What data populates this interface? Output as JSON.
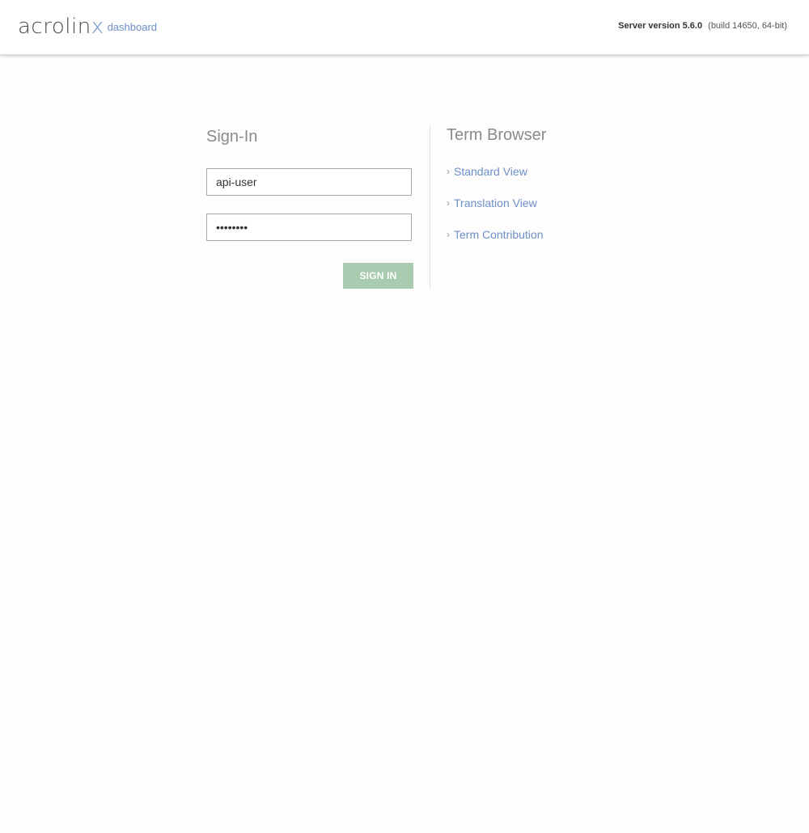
{
  "header": {
    "logo_text": "acrolin",
    "logo_x": "x",
    "logo_sub": "dashboard",
    "server_version_label": "Server version 5.6.0",
    "server_build": "(build 14650, 64-bit)"
  },
  "signin": {
    "title": "Sign-In",
    "username_value": "api-user",
    "password_value": "••••••••",
    "button_label": "SIGN IN"
  },
  "term_browser": {
    "title": "Term Browser",
    "links": [
      {
        "label": "Standard View"
      },
      {
        "label": "Translation View"
      },
      {
        "label": "Term Contribution"
      }
    ]
  },
  "colors": {
    "accent": "#6d8fc9",
    "button": "#a9cbb0",
    "text_muted": "#8a8a8a"
  }
}
